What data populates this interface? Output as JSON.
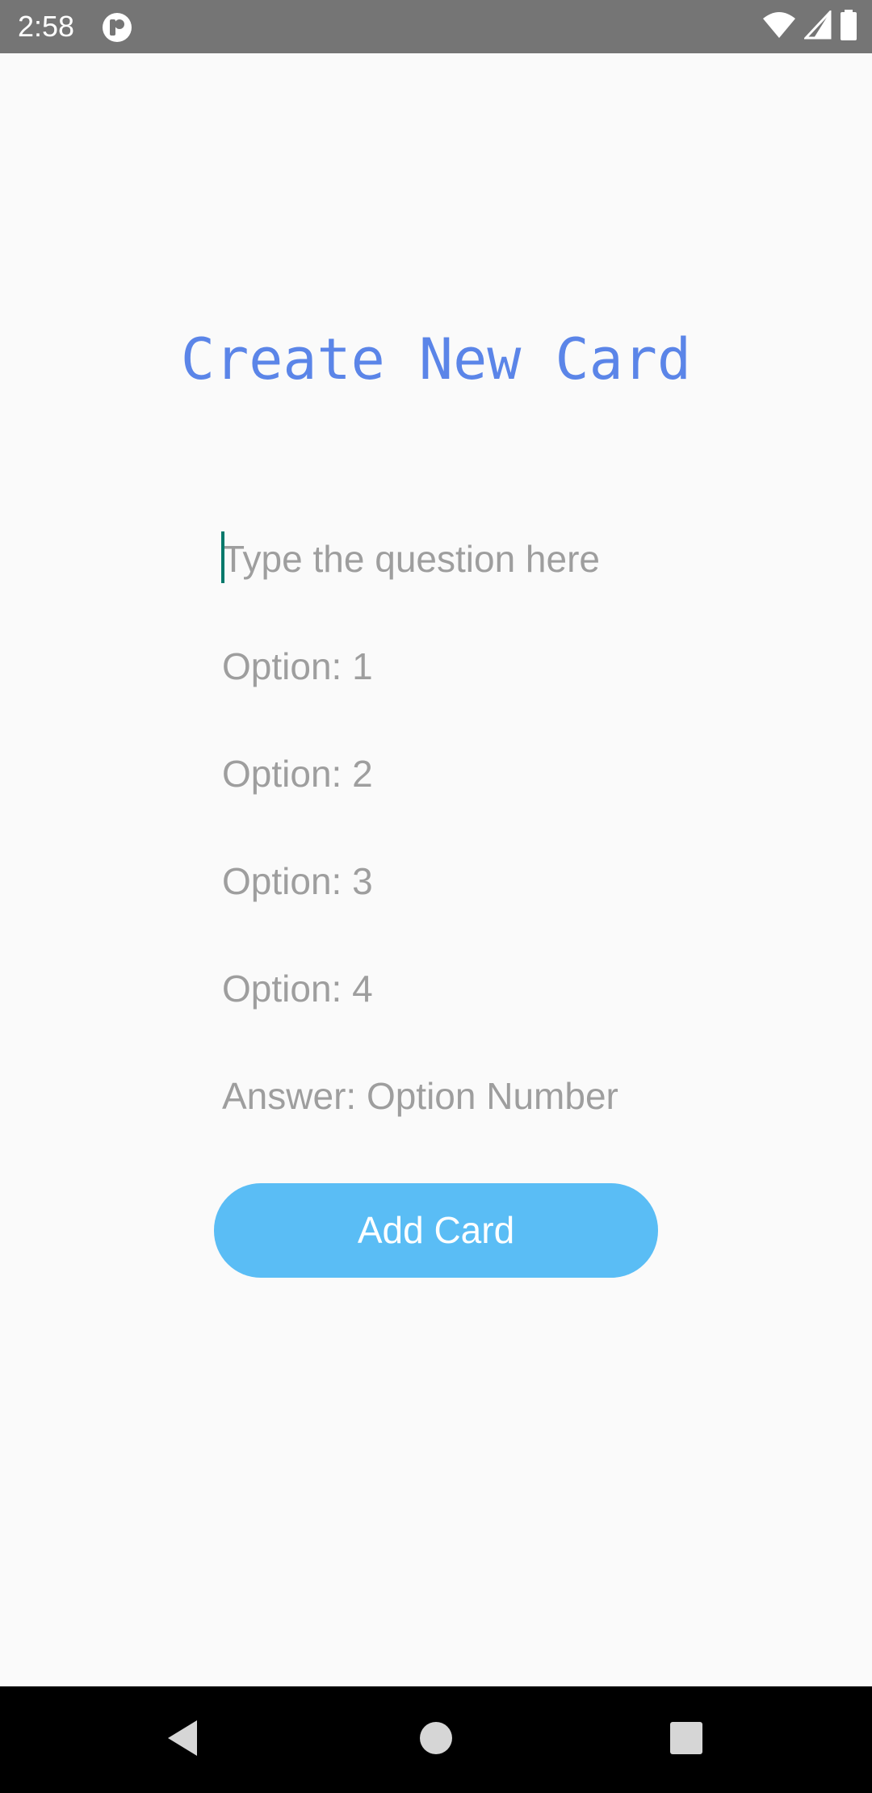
{
  "status_bar": {
    "time": "2:58",
    "icons": [
      "app-notification-icon",
      "wifi-icon",
      "cell-signal-icon",
      "battery-icon"
    ]
  },
  "title": "Create New Card",
  "form": {
    "question_placeholder": "Type the question here",
    "option1_placeholder": "Option: 1",
    "option2_placeholder": "Option: 2",
    "option3_placeholder": "Option: 3",
    "option4_placeholder": "Option: 4",
    "answer_placeholder": "Answer: Option Number",
    "add_button_label": "Add Card"
  },
  "nav_bar": {
    "icons": [
      "back-icon",
      "home-icon",
      "recents-icon"
    ]
  },
  "colors": {
    "title": "#5b85e8",
    "button": "#5abdf5",
    "placeholder": "#9e9e9e",
    "cursor": "#00796b",
    "status_bar": "#757575",
    "background": "#fafafa"
  }
}
